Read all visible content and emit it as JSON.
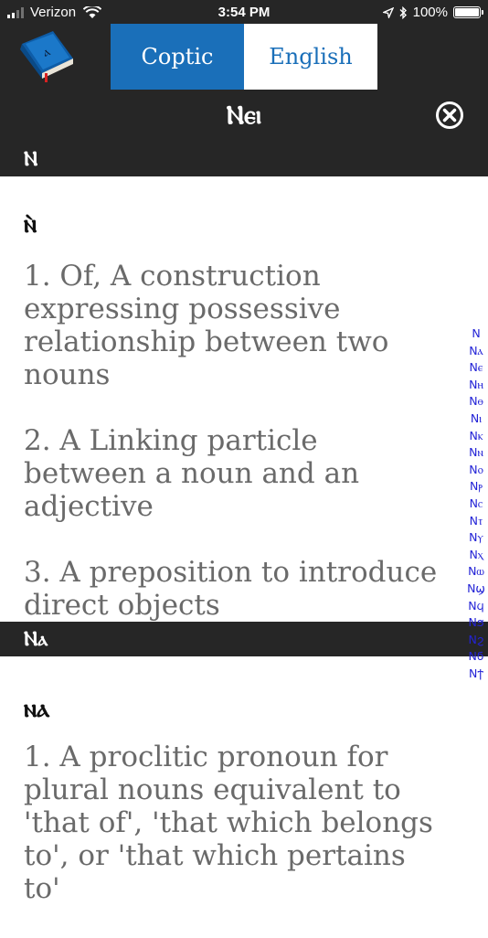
{
  "status_bar": {
    "carrier": "Verizon",
    "time": "3:54 PM",
    "battery_percent": "100%",
    "battery_level": 1.0,
    "signal_bars": 2
  },
  "language_toggle": {
    "options": [
      "Coptic",
      "English"
    ],
    "selected": "Coptic"
  },
  "header": {
    "title": "Ⲛⲉⲓ",
    "close_icon": "close-circle-icon",
    "app_icon": "book-icon"
  },
  "sections": [
    {
      "header": "Ⲛ",
      "word": "ⲛ̀",
      "definitions": [
        "1. Of, A construction expressing possessive relationship between two nouns",
        "2. A Linking particle between a noun and an adjective",
        "3. A preposition to introduce direct objects"
      ]
    },
    {
      "header": "Ⲛⲁ",
      "word": "ⲛⲁ",
      "definitions": [
        "1. A proclitic pronoun for plural nouns equivalent to 'that of', 'that which belongs to', or 'that which pertains to'"
      ]
    }
  ],
  "index_items": [
    "N",
    "Nⲁ",
    "Nⲉ",
    "Nⲏ",
    "Nⲑ",
    "Nⲓ",
    "Nⲕ",
    "Nⲛ",
    "Nⲟ",
    "Nⲣ",
    "Nⲥ",
    "Nⲧ",
    "Nⲩ",
    "Nⲭ",
    "Nⲱ",
    "Nϣ",
    "Nϥ",
    "Nϧ",
    "Nϩ",
    "Nϭ",
    "Nϯ"
  ],
  "colors": {
    "accent": "#1a6fb9",
    "dark_bar": "#262626",
    "definition_text": "#6a6a6a",
    "index_text": "#2323d6"
  }
}
